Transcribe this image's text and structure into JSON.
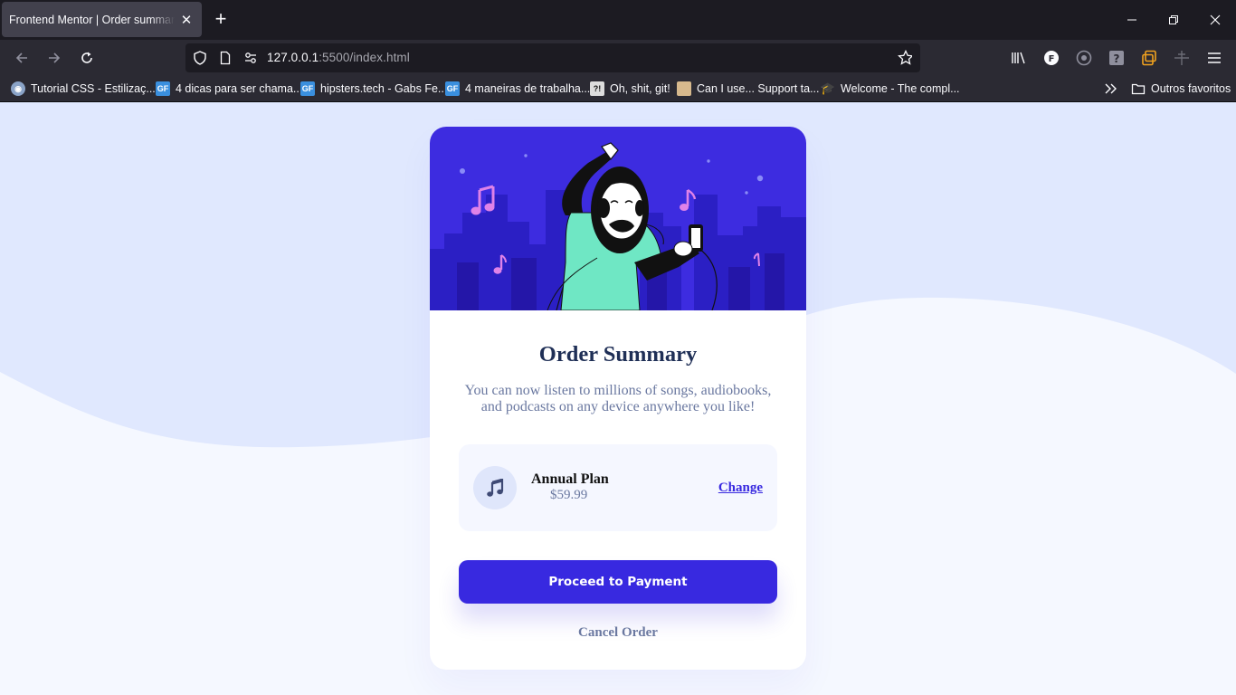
{
  "browser": {
    "tab_title": "Frontend Mentor | Order summary c",
    "url_host": "127.0.0.1",
    "url_path": ":5500/index.html"
  },
  "bookmarks": [
    {
      "label": "Tutorial CSS - Estilizaç...",
      "icon": "globe-icon",
      "color": "#8aa3c7"
    },
    {
      "label": "4 dicas para ser chama...",
      "icon": "gf-icon",
      "color": "#3a8fde"
    },
    {
      "label": "hipsters.tech - Gabs Fe...",
      "icon": "gf-icon",
      "color": "#3a8fde"
    },
    {
      "label": "4 maneiras de trabalha...",
      "icon": "gf-icon",
      "color": "#3a8fde"
    },
    {
      "label": "Oh, shit, git!",
      "icon": "git-icon",
      "color": "#dddddd"
    },
    {
      "label": "Can I use... Support ta...",
      "icon": "caniuse-icon",
      "color": "#d7b98d"
    },
    {
      "label": "Welcome - The compl...",
      "icon": "graduation-cap-icon",
      "color": "#222222"
    }
  ],
  "bookmarks_other": "Outros favoritos",
  "page": {
    "title": "Order Summary",
    "description": "You can now listen to millions of songs, audiobooks, and podcasts on any device anywhere you like!",
    "plan_name": "Annual Plan",
    "plan_price": "$59.99",
    "change_label": "Change",
    "proceed_label": "Proceed to Payment",
    "cancel_label": "Cancel Order"
  },
  "colors": {
    "primary": "#3829e0",
    "page_bg": "#e0e8fe",
    "title": "#1f2f56",
    "desc": "#6a78a0"
  }
}
